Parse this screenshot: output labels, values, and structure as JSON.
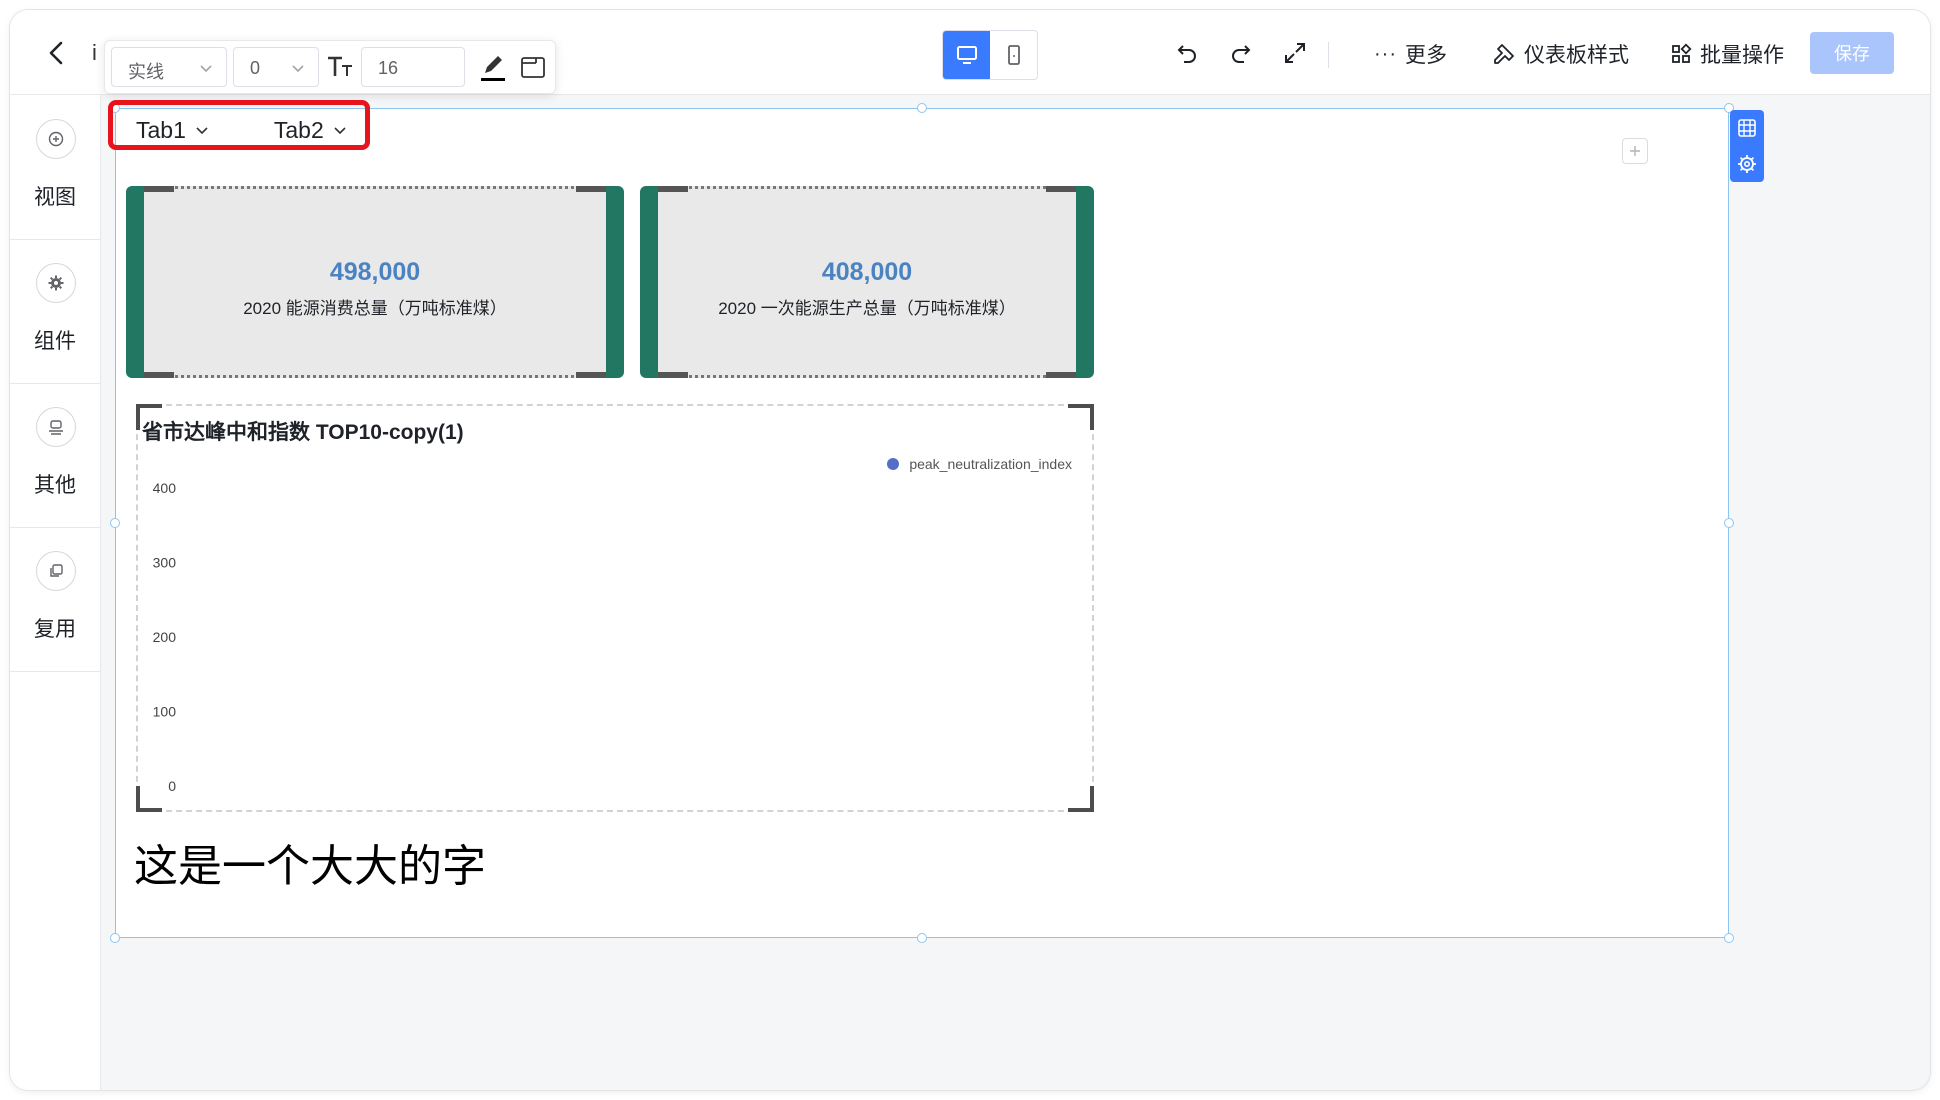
{
  "header": {
    "title_peek": "i",
    "style_toolbar": {
      "line_style": "实线",
      "border_width": "0",
      "font_size": "16"
    },
    "actions": {
      "more": "更多",
      "dashboard_style": "仪表板样式",
      "batch_ops": "批量操作",
      "save": "保存"
    }
  },
  "sidebar": {
    "items": [
      {
        "label": "视图",
        "icon": "plus-circle-icon"
      },
      {
        "label": "组件",
        "icon": "gear-icon"
      },
      {
        "label": "其他",
        "icon": "stamp-icon"
      },
      {
        "label": "复用",
        "icon": "copy-icon"
      }
    ]
  },
  "tabs": [
    {
      "label": "Tab1"
    },
    {
      "label": "Tab2"
    }
  ],
  "kpis": [
    {
      "value": "498,000",
      "label": "2020 能源消费总量（万吨标准煤）"
    },
    {
      "value": "408,000",
      "label": "2020 一次能源生产总量（万吨标准煤）"
    }
  ],
  "chart_data": {
    "type": "bar",
    "title": "省市达峰中和指数 TOP10-copy(1)",
    "legend_position": "top-right",
    "series": [
      {
        "name": "peak_neutralization_index",
        "values": [],
        "color": "#5470c6"
      }
    ],
    "categories": [],
    "ylim": [
      0,
      400
    ],
    "yticks": [
      "400",
      "300",
      "200",
      "100",
      "0"
    ]
  },
  "text_block": "这是一个大大的字"
}
